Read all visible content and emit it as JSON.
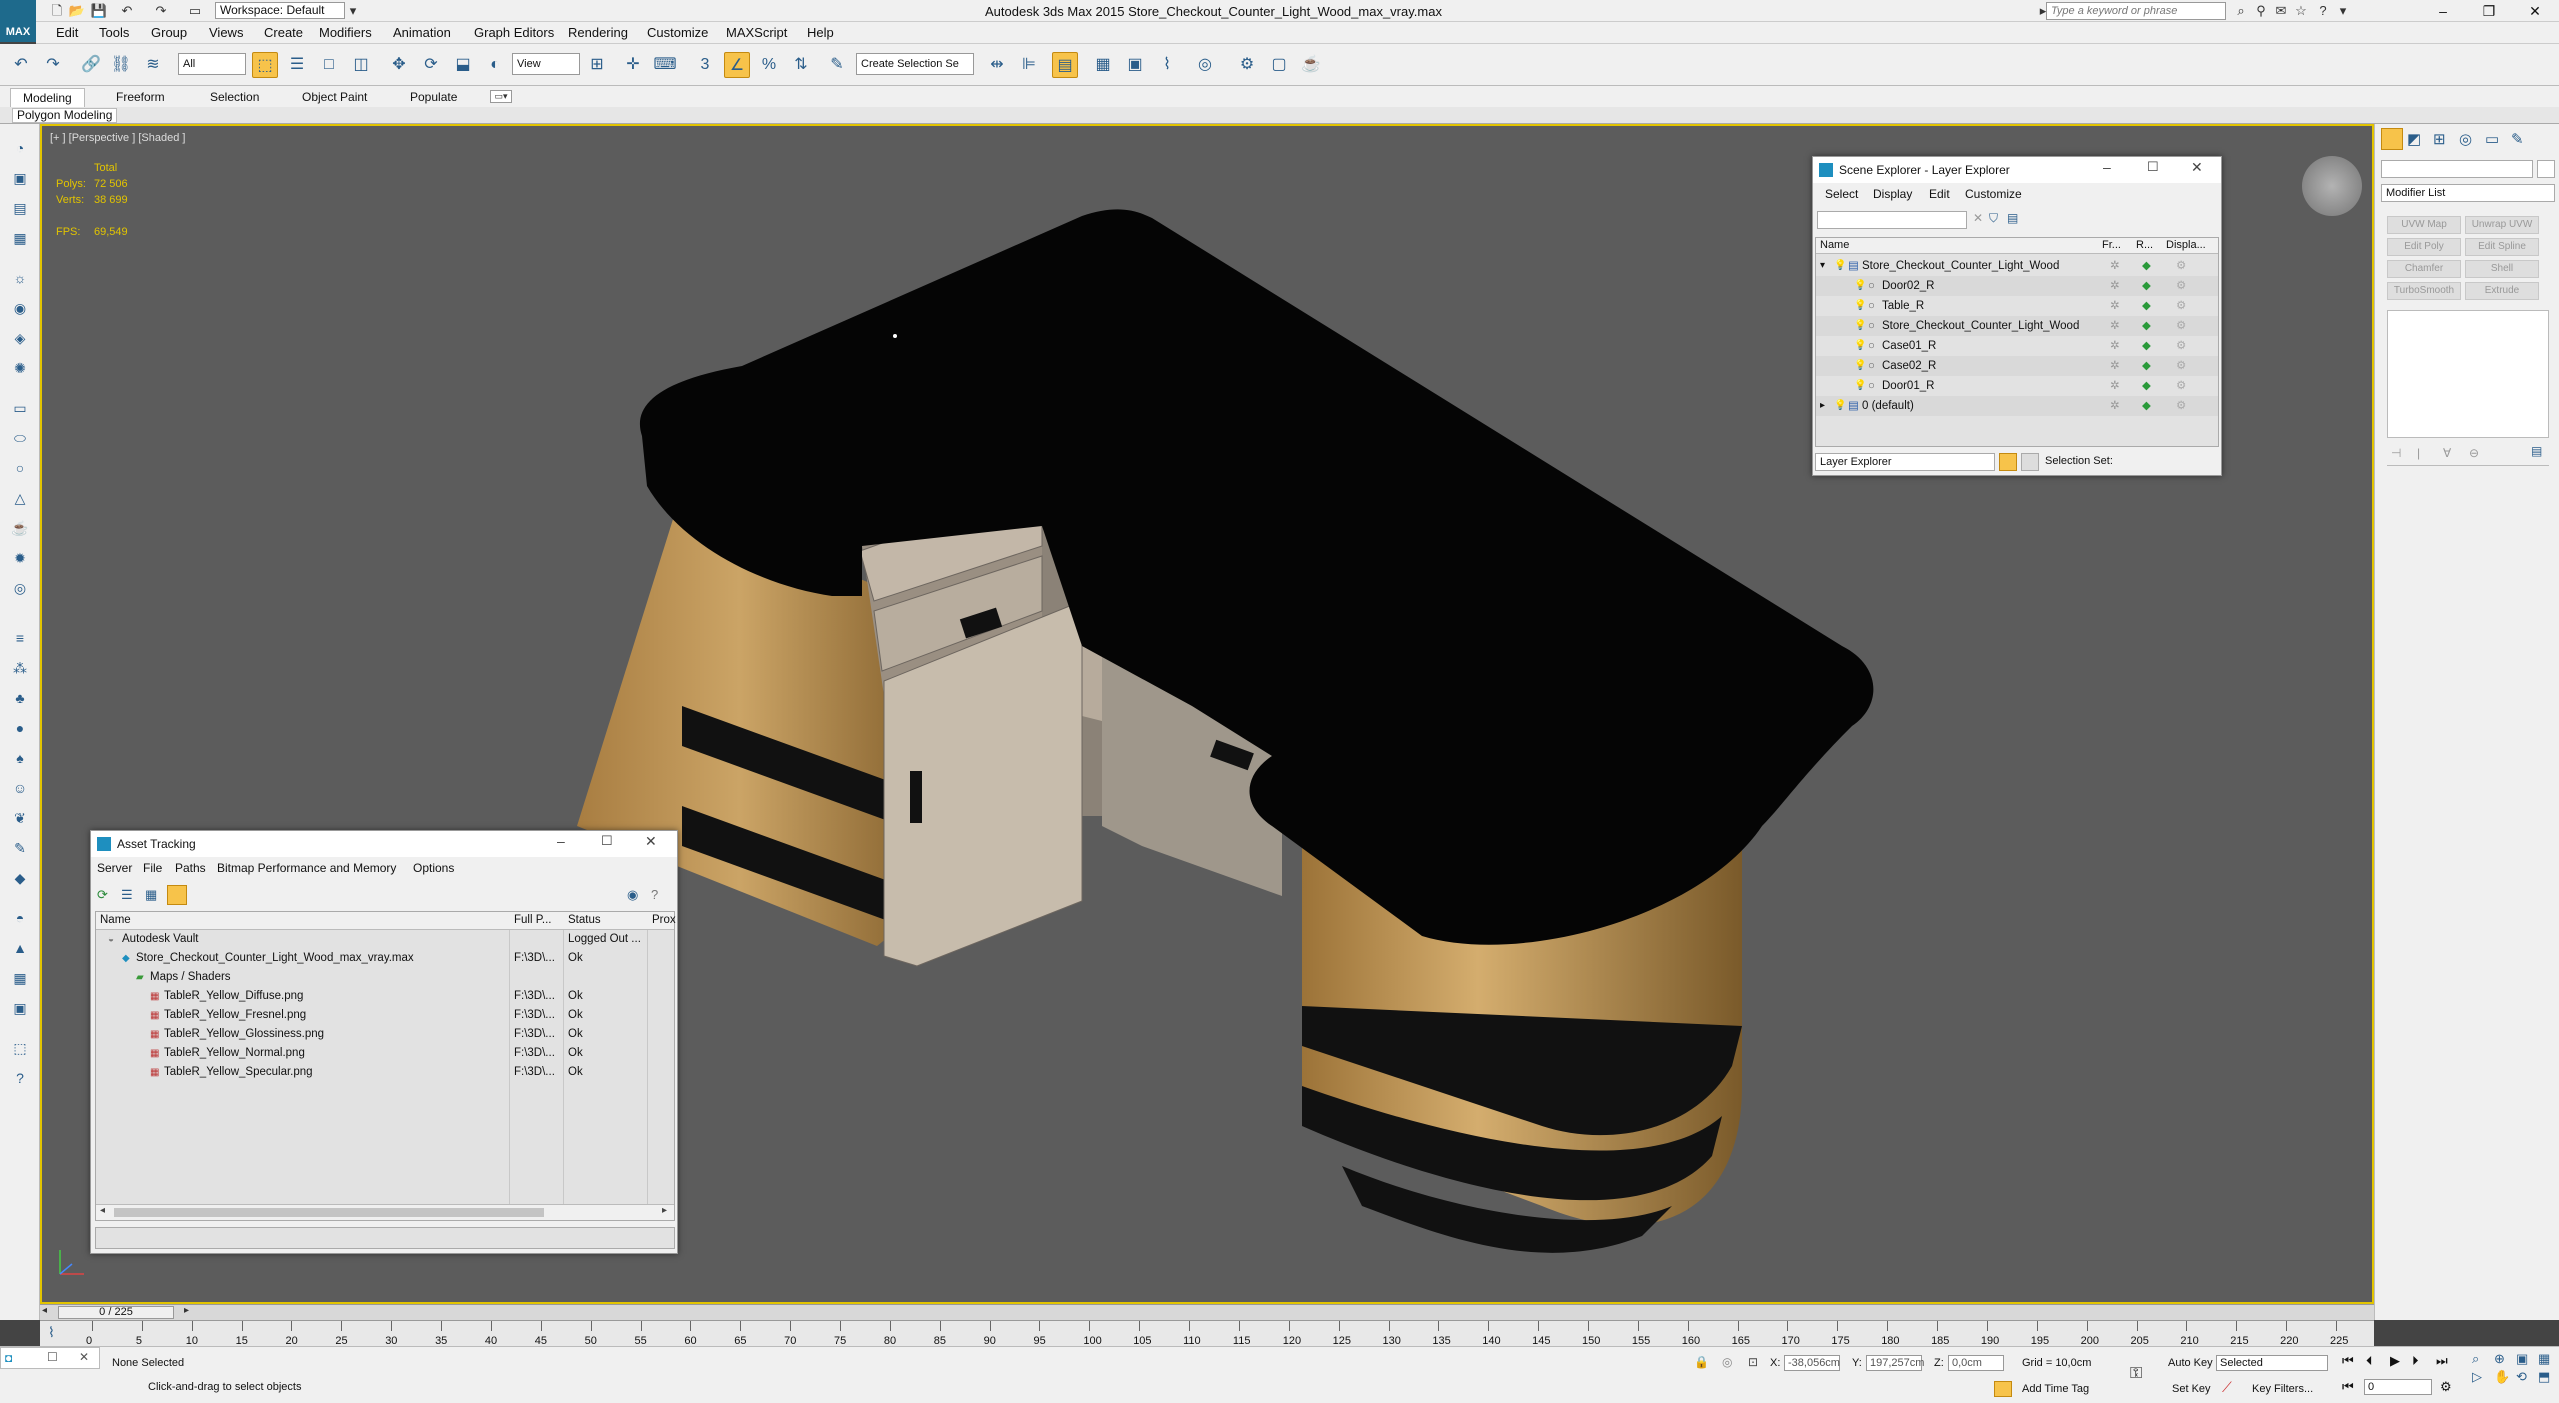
{
  "app": {
    "logo_text": "MAX",
    "title": "Autodesk 3ds Max  2015     Store_Checkout_Counter_Light_Wood_max_vray.max",
    "workspace": "Workspace: Default",
    "search_placeholder": "Type a keyword or phrase"
  },
  "menu": [
    "Edit",
    "Tools",
    "Group",
    "Views",
    "Create",
    "Modifiers",
    "Animation",
    "Graph Editors",
    "Rendering",
    "Customize",
    "MAXScript",
    "Help"
  ],
  "toolbar": {
    "filter": "All",
    "ref_coord": "View",
    "selection_set": "Create Selection Se"
  },
  "ribbon": {
    "tabs": [
      "Modeling",
      "Freeform",
      "Selection",
      "Object Paint",
      "Populate"
    ],
    "panel_label": "Polygon Modeling"
  },
  "viewport": {
    "label": "[+ ] [Perspective ] [Shaded ]",
    "stats_header": "Total",
    "polys_label": "Polys:",
    "polys": "72 506",
    "verts_label": "Verts:",
    "verts": "38 699",
    "fps_label": "FPS:",
    "fps": "69,549",
    "background_color": "#5c5c5c",
    "border_color": "#e2c400"
  },
  "scene_explorer": {
    "title": "Scene Explorer - Layer Explorer",
    "menu": [
      "Select",
      "Display",
      "Edit",
      "Customize"
    ],
    "columns": [
      "Name",
      "Fr...",
      "R...",
      "Displa..."
    ],
    "rows": [
      {
        "name": "Store_Checkout_Counter_Light_Wood",
        "level": 0
      },
      {
        "name": "Door02_R",
        "level": 1
      },
      {
        "name": "Table_R",
        "level": 1
      },
      {
        "name": "Store_Checkout_Counter_Light_Wood",
        "level": 1
      },
      {
        "name": "Case01_R",
        "level": 1
      },
      {
        "name": "Case02_R",
        "level": 1
      },
      {
        "name": "Door01_R",
        "level": 1
      },
      {
        "name": "0 (default)",
        "level": 0
      }
    ],
    "footer_dropdown": "Layer Explorer",
    "selection_set_label": "Selection Set:"
  },
  "asset_tracking": {
    "title": "Asset Tracking",
    "menu": [
      "Server",
      "File",
      "Paths",
      "Bitmap Performance and Memory",
      "Options"
    ],
    "columns": [
      "Name",
      "Full P...",
      "Status",
      "Prox"
    ],
    "rows": [
      {
        "name": "Autodesk Vault",
        "path": "",
        "status": "Logged Out ...",
        "level": 0
      },
      {
        "name": "Store_Checkout_Counter_Light_Wood_max_vray.max",
        "path": "F:\\3D\\...",
        "status": "Ok",
        "level": 1
      },
      {
        "name": "Maps / Shaders",
        "path": "",
        "status": "",
        "level": 2
      },
      {
        "name": "TableR_Yellow_Diffuse.png",
        "path": "F:\\3D\\...",
        "status": "Ok",
        "level": 3
      },
      {
        "name": "TableR_Yellow_Fresnel.png",
        "path": "F:\\3D\\...",
        "status": "Ok",
        "level": 3
      },
      {
        "name": "TableR_Yellow_Glossiness.png",
        "path": "F:\\3D\\...",
        "status": "Ok",
        "level": 3
      },
      {
        "name": "TableR_Yellow_Normal.png",
        "path": "F:\\3D\\...",
        "status": "Ok",
        "level": 3
      },
      {
        "name": "TableR_Yellow_Specular.png",
        "path": "F:\\3D\\...",
        "status": "Ok",
        "level": 3
      }
    ]
  },
  "command_panel": {
    "modifier_list": "Modifier List",
    "buttons": [
      "UVW Map",
      "Unwrap UVW",
      "Edit Poly",
      "Edit Spline",
      "Chamfer",
      "Shell",
      "TurboSmooth",
      "Extrude"
    ]
  },
  "timeline": {
    "frame_label": "0 / 225",
    "ticks": [
      "0",
      "5",
      "10",
      "15",
      "20",
      "25",
      "30",
      "35",
      "40",
      "45",
      "50",
      "55",
      "60",
      "65",
      "70",
      "75",
      "80",
      "85",
      "90",
      "95",
      "100",
      "105",
      "110",
      "115",
      "120",
      "125",
      "130",
      "135",
      "140",
      "145",
      "150",
      "155",
      "160",
      "165",
      "170",
      "175",
      "180",
      "185",
      "190",
      "195",
      "200",
      "205",
      "210",
      "215",
      "220",
      "225"
    ]
  },
  "status": {
    "selection": "None Selected",
    "prompt": "Click-and-drag to select objects",
    "x_label": "X:",
    "x": "-38,056cm",
    "y_label": "Y:",
    "y": "197,257cm",
    "z_label": "Z:",
    "z": "0,0cm",
    "grid": "Grid = 10,0cm",
    "add_time_tag": "Add Time Tag",
    "auto_key": "Auto Key",
    "auto_key_mode": "Selected",
    "set_key": "Set Key",
    "key_filters": "Key Filters...",
    "current_frame": "0"
  }
}
